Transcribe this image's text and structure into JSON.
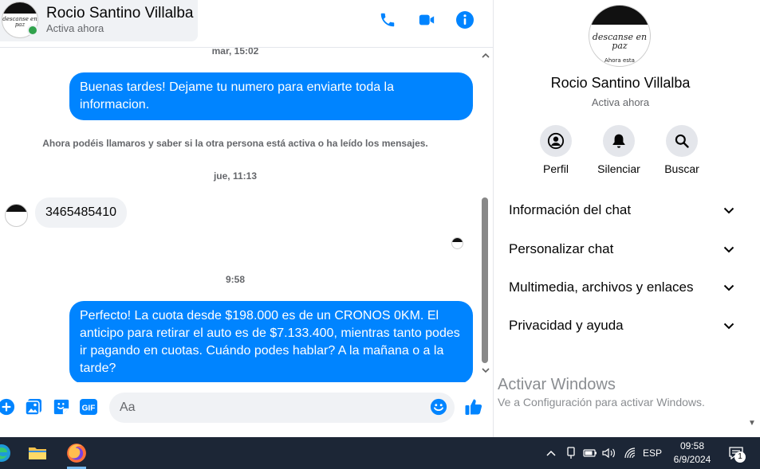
{
  "contact": {
    "name": "Rocio Santino Villalba",
    "status": "Activa ahora",
    "avatar_text": "descanse en paz",
    "avatar_small_text": "Ahora esta"
  },
  "messages": {
    "ts1": "mar, 15:02",
    "msg1": "Buenas tardes! Dejame tu numero para enviarte toda la informacion.",
    "system_note": "Ahora podéis llamaros y saber si la otra persona está activa o ha leído los mensajes.",
    "ts2": "jue, 11:13",
    "msg2": "3465485410",
    "ts3": "9:58",
    "msg3": "Perfecto! La cuota desde $198.000 es de un CRONOS 0KM. El anticipo para retirar el auto es de $7.133.400, mientras tanto podes ir pagando en cuotas. Cuándo podes hablar? A la mañana o a la tarde?"
  },
  "composer": {
    "placeholder": "Aa"
  },
  "info": {
    "actions": [
      {
        "label": "Perfil",
        "icon": "profile-icon"
      },
      {
        "label": "Silenciar",
        "icon": "bell-icon"
      },
      {
        "label": "Buscar",
        "icon": "search-icon"
      }
    ],
    "sections": [
      {
        "label": "Información del chat"
      },
      {
        "label": "Personalizar chat"
      },
      {
        "label": "Multimedia, archivos y enlaces"
      },
      {
        "label": "Privacidad y ayuda"
      }
    ]
  },
  "watermark": {
    "title": "Activar Windows",
    "subtitle": "Ve a Configuración para activar Windows."
  },
  "taskbar": {
    "lang": "ESP",
    "time": "09:58",
    "date": "6/9/2024",
    "notification_count": "1"
  },
  "colors": {
    "accent": "#0084ff",
    "online": "#31a24c",
    "taskbar": "#1c2636"
  }
}
